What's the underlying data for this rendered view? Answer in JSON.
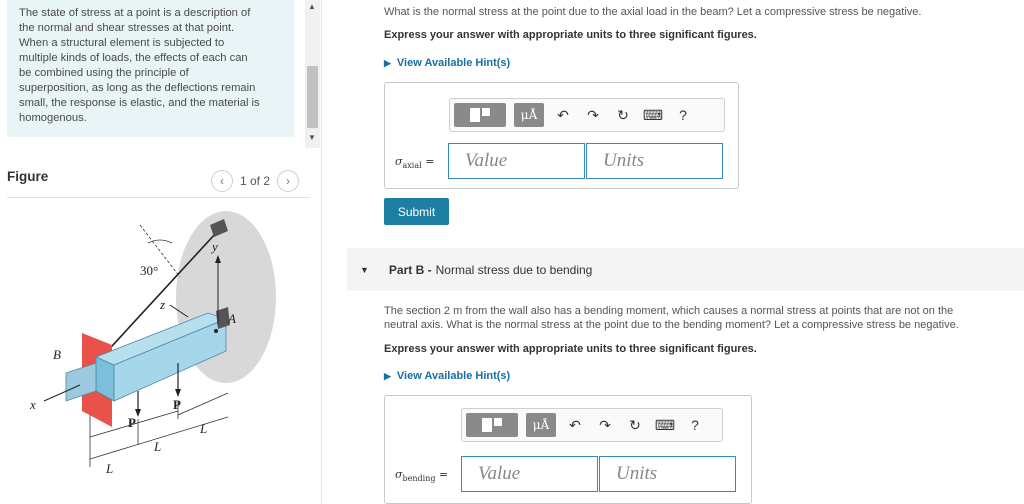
{
  "intro": {
    "lines": [
      "The state of stress at a point is a description of",
      "the normal and shear stresses at that point.",
      "When a structural element is subjected to",
      "multiple kinds of loads, the effects of each can",
      "be combined using the principle of",
      "superposition, as long as the deflections remain",
      "small, the response is elastic, and the material is",
      "homogenous."
    ]
  },
  "figure": {
    "title": "Figure",
    "pager": "1 of 2",
    "labels": {
      "angle": "30°",
      "y": "y",
      "z": "z",
      "x": "x",
      "b": "B",
      "a": "A",
      "p1": "P",
      "p2": "P",
      "l1": "L",
      "l2": "L",
      "l3": "L"
    }
  },
  "partA": {
    "question": "What is the normal stress at the point due to the axial load in the beam? Let a compressive stress be negative.",
    "instruction": "Express your answer with appropriate units to three significant figures.",
    "hint": "View Available Hint(s)",
    "var_symbol": "σ",
    "var_sub": "axial",
    "equals": "=",
    "value_placeholder": "Value",
    "units_placeholder": "Units",
    "submit": "Submit",
    "mu": "μÅ",
    "help": "?"
  },
  "partB": {
    "label": "Part B -",
    "title": "Normal stress due to bending",
    "question_lines": [
      "The section 2 m from the wall also has a bending moment, which causes a normal stress at points that are not on the",
      "neutral axis. What is the normal stress at the point due to the bending moment? Let a compressive stress be negative."
    ],
    "instruction": "Express your answer with appropriate units to three significant figures.",
    "hint": "View Available Hint(s)",
    "var_symbol": "σ",
    "var_sub": "bending",
    "equals": "=",
    "value_placeholder": "Value",
    "units_placeholder": "Units",
    "mu": "μÅ",
    "help": "?"
  }
}
